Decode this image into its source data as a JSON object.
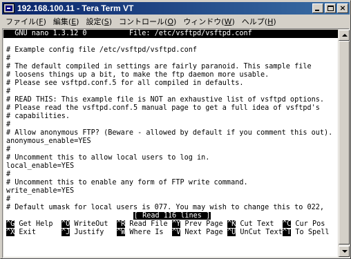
{
  "window": {
    "title": "192.168.100.11 - Tera Term VT",
    "controls": {
      "minimize": "minimize",
      "maximize": "maximize",
      "close": "×"
    }
  },
  "menu": [
    {
      "label": "ファイル(",
      "key": "F",
      "suffix": ")"
    },
    {
      "label": "編集(",
      "key": "E",
      "suffix": ")"
    },
    {
      "label": "設定(",
      "key": "S",
      "suffix": ")"
    },
    {
      "label": "コントロール(",
      "key": "O",
      "suffix": ")"
    },
    {
      "label": "ウィンドウ(",
      "key": "W",
      "suffix": ")"
    },
    {
      "label": "ヘルプ(",
      "key": "H",
      "suffix": ")"
    }
  ],
  "nano": {
    "header": "  GNU nano 1.3.12 0          File: /etc/vsftpd/vsftpd.conf",
    "lines": [
      "",
      "# Example config file /etc/vsftpd/vsftpd.conf",
      "#",
      "# The default compiled in settings are fairly paranoid. This sample file",
      "# loosens things up a bit, to make the ftp daemon more usable.",
      "# Please see vsftpd.conf.5 for all compiled in defaults.",
      "#",
      "# READ THIS: This example file is NOT an exhaustive list of vsftpd options.",
      "# Please read the vsftpd.conf.5 manual page to get a full idea of vsftpd's",
      "# capabilities.",
      "#",
      "# Allow anonymous FTP? (Beware - allowed by default if you comment this out).",
      "anonymous_enable=YES",
      "#",
      "# Uncomment this to allow local users to log in.",
      "local_enable=YES",
      "#",
      "# Uncomment this to enable any form of FTP write command.",
      "write_enable=YES",
      "#",
      "# Default umask for local users is 077. You may wish to change this to 022,"
    ],
    "status": "[ Read 116 lines ]",
    "shortcuts_row1": [
      {
        "key": "^G",
        "label": " Get Help"
      },
      {
        "key": "^O",
        "label": " WriteOut"
      },
      {
        "key": "^R",
        "label": " Read File"
      },
      {
        "key": "^Y",
        "label": " Prev Page"
      },
      {
        "key": "^K",
        "label": " Cut Text"
      },
      {
        "key": "^C",
        "label": " Cur Pos"
      }
    ],
    "shortcuts_row2": [
      {
        "key": "^X",
        "label": " Exit"
      },
      {
        "key": "^J",
        "label": " Justify"
      },
      {
        "key": "^W",
        "label": " Where Is"
      },
      {
        "key": "^V",
        "label": " Next Page"
      },
      {
        "key": "^U",
        "label": " UnCut Text"
      },
      {
        "key": "^T",
        "label": " To Spell"
      }
    ]
  }
}
